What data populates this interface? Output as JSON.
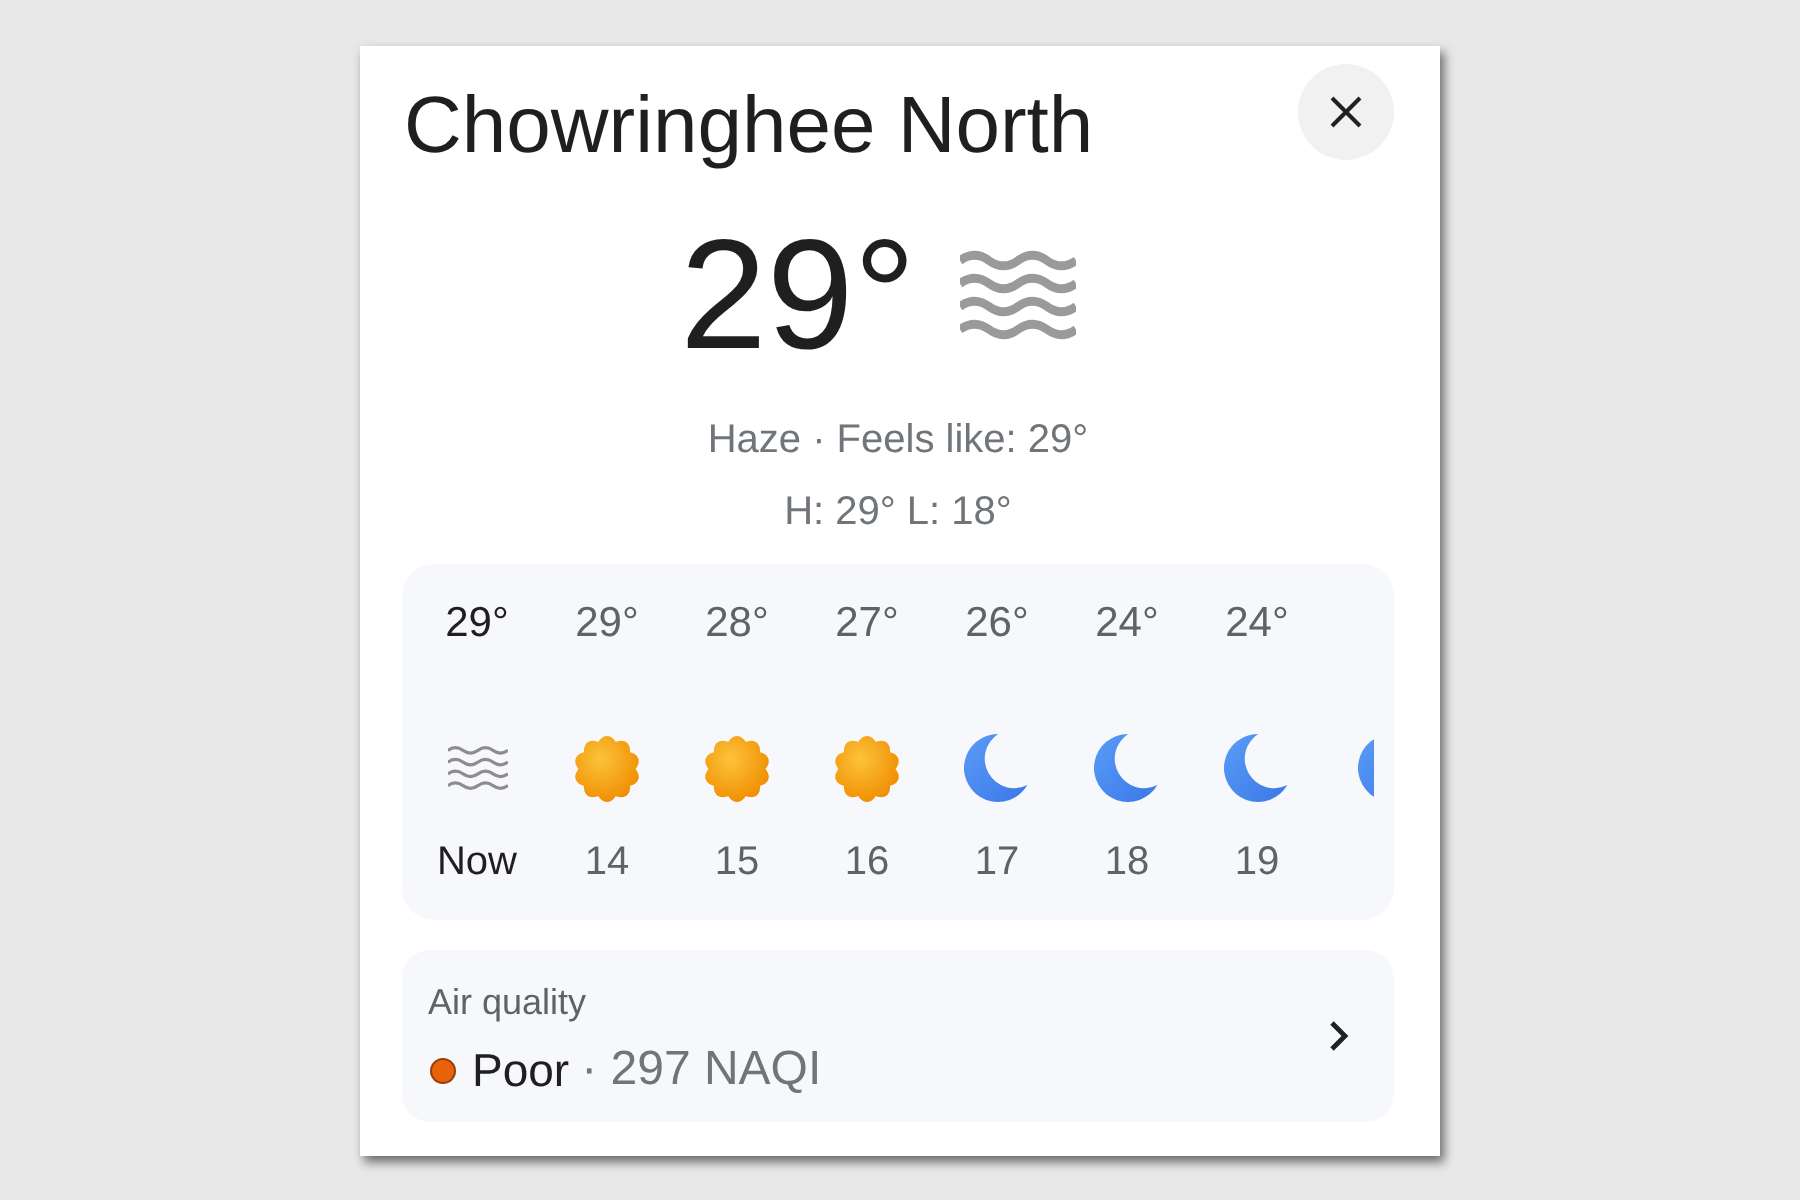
{
  "location": {
    "title": "Chowringhee North"
  },
  "current": {
    "temperature": "29°",
    "condition_icon": {
      "kind": "haze"
    },
    "summary": "Haze · Feels like: 29°",
    "high_low": "H: 29° L: 18°"
  },
  "hourly": {
    "hours": [
      {
        "temperature": "29°",
        "kind": "haze",
        "time": "Now",
        "current": true
      },
      {
        "temperature": "29°",
        "kind": "sun",
        "time": "14",
        "current": false
      },
      {
        "temperature": "28°",
        "kind": "sun",
        "time": "15",
        "current": false
      },
      {
        "temperature": "27°",
        "kind": "sun",
        "time": "16",
        "current": false
      },
      {
        "temperature": "26°",
        "kind": "moon",
        "time": "17",
        "current": false
      },
      {
        "temperature": "24°",
        "kind": "moon",
        "time": "18",
        "current": false
      },
      {
        "temperature": "24°",
        "kind": "moon",
        "time": "19",
        "current": false
      }
    ],
    "partial_hour": {
      "kind": "moon"
    }
  },
  "air_quality": {
    "title": "Air quality",
    "color": "#e8620c",
    "category": "Poor",
    "reading": "· 297 NAQI"
  }
}
